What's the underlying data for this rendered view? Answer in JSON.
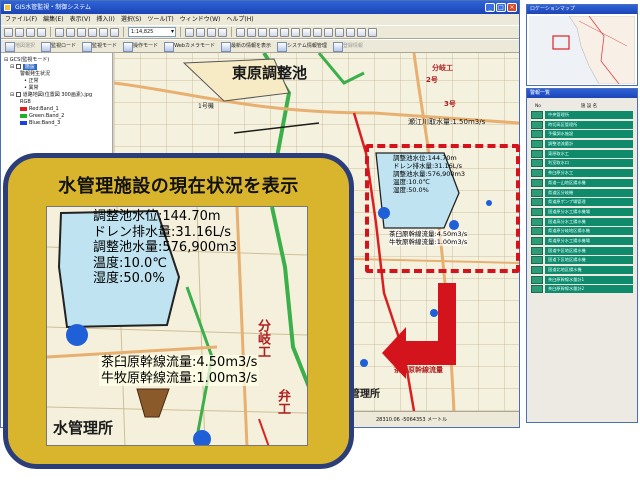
{
  "window": {
    "title": "GIS水管監視・制御システム",
    "controls": [
      "_",
      "□",
      "×"
    ]
  },
  "menu": [
    "ファイル(F)",
    "編集(E)",
    "表示(V)",
    "挿入(I)",
    "選択(S)",
    "ツール(T)",
    "ウィンドウ(W)",
    "ヘルプ(H)"
  ],
  "toolbar": {
    "scale": "1:14,825",
    "buttons": [
      "地図選択",
      "監視ロード",
      "監視モード",
      "操作モード",
      "Webカメラモード",
      "最新の情報を表示",
      "システム情報管理",
      "登録情報"
    ]
  },
  "layers": {
    "root": "GCS(監視モード)",
    "selected": "施設",
    "items": [
      "警報発生状況",
      "正常",
      "異常"
    ],
    "raster": "道路地図(位置図 300画素).jpg",
    "rgb_label": "RGB",
    "bands": [
      {
        "label": "Red:Band_1",
        "color": "#e02020"
      },
      {
        "label": "Green:Band_2",
        "color": "#20b020"
      },
      {
        "label": "Blue:Band_3",
        "color": "#2040e0"
      }
    ]
  },
  "map": {
    "labels": {
      "reservoir": "東原調整池",
      "river_gauge": "瀬江川取水量:1.50m3/s",
      "well1": "1号機",
      "well2": "2号",
      "well3": "3号",
      "branch": "分岐工",
      "flow_main": "茶臼原幹線流量",
      "office": "水管理所"
    },
    "info": [
      "調整池水位:144.70m",
      "ドレン排水量:31.16L/s",
      "調整池水量:576,900m3",
      "温度:10.0℃",
      "湿度:50.0%"
    ],
    "flows": [
      "茶臼原幹線流量:4.50m3/s",
      "牛牧原幹線流量:1.00m3/s"
    ],
    "status_text": "28310.06 -5064353 メートル"
  },
  "overview": {
    "title": "ロケーションマップ"
  },
  "warnings": {
    "title": "警報一覧",
    "col_no": "No",
    "col_name": "施 設 名",
    "items": [
      "中央管理所",
      "時切高区管理所",
      "予備調水施設",
      "調整池流量計",
      "東原取水工",
      "利室取水口",
      "茶臼原分水工",
      "県道一山地区揚水機",
      "県道区分岐機",
      "県道原ポンプ場管理",
      "国道原分水工揚水機場",
      "国道高分水工揚水機",
      "県道原分岐地区揚水機",
      "県道原分水工揚水機場",
      "国道中区地区揚水機",
      "国道下区地区揚水機",
      "国道北地区揚水機",
      "茶臼原幹線水量計1",
      "茶臼原幹線水量計2"
    ]
  },
  "callout": {
    "title": "水管理施設の現在状況を表示",
    "info": [
      "調整池水位:144.70m",
      "ドレン排水量:31.16L/s",
      "調整池水量:576,900m3",
      "温度:10.0℃",
      "湿度:50.0%"
    ],
    "flows": [
      "茶臼原幹線流量:4.50m3/s",
      "牛牧原幹線流量:1.00m3/s"
    ],
    "labels": {
      "office": "水管理所",
      "branch": "分岐工",
      "valve": "弁工"
    }
  },
  "colors": {
    "accent_red": "#d4141c",
    "callout_fill": "#d9b52e",
    "callout_border": "#2c3e7a",
    "water": "#bfe3f0",
    "marker": "#1f5fd8",
    "warning_green": "#0f8a6b"
  }
}
